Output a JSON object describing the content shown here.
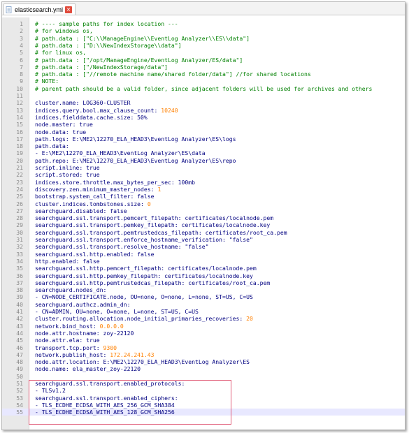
{
  "tab": {
    "filename": "elasticsearch.yml"
  },
  "lines": [
    {
      "n": "1",
      "parts": [
        [
          "comment",
          "# ---- sample paths for index location ---"
        ]
      ]
    },
    {
      "n": "2",
      "parts": [
        [
          "comment",
          "# for windows os,"
        ]
      ]
    },
    {
      "n": "3",
      "parts": [
        [
          "comment",
          "# path.data : [\"C:\\\\ManageEngine\\\\EventLog Analyzer\\\\ES\\\\data\"]"
        ]
      ]
    },
    {
      "n": "4",
      "parts": [
        [
          "comment",
          "# path.data : [\"D:\\\\NewIndexStorage\\\\data\"]"
        ]
      ]
    },
    {
      "n": "5",
      "parts": [
        [
          "comment",
          "# for linux os,"
        ]
      ]
    },
    {
      "n": "6",
      "parts": [
        [
          "comment",
          "# path.data : [\"/opt/ManageEngine/EventLog Analyzer/ES/data\"]"
        ]
      ]
    },
    {
      "n": "7",
      "parts": [
        [
          "comment",
          "# path.data : [\"/NewIndexStorage/data\"]"
        ]
      ]
    },
    {
      "n": "8",
      "parts": [
        [
          "comment",
          "# path.data : [\"//remote machine name/shared folder/data\"] //for shared locations"
        ]
      ]
    },
    {
      "n": "9",
      "parts": [
        [
          "comment",
          "# NOTE:"
        ]
      ]
    },
    {
      "n": "10",
      "parts": [
        [
          "comment",
          "# parent path should be a valid folder, since adjacent folders will be used for archives and others"
        ]
      ]
    },
    {
      "n": "11",
      "parts": []
    },
    {
      "n": "12",
      "parts": [
        [
          "key",
          "cluster.name: LOG360-CLUSTER"
        ]
      ]
    },
    {
      "n": "13",
      "parts": [
        [
          "key",
          "indices.query.bool.max_clause_count: "
        ],
        [
          "num",
          "10240"
        ]
      ]
    },
    {
      "n": "14",
      "parts": [
        [
          "key",
          "indices.fielddata.cache.size: 50%"
        ]
      ]
    },
    {
      "n": "15",
      "parts": [
        [
          "key",
          "node.master: true"
        ]
      ]
    },
    {
      "n": "16",
      "parts": [
        [
          "key",
          "node.data: true"
        ]
      ]
    },
    {
      "n": "17",
      "parts": [
        [
          "key",
          "path.logs: E:\\ME2\\12270_ELA_HEAD3\\EventLog Analyzer\\ES\\logs"
        ]
      ]
    },
    {
      "n": "18",
      "parts": [
        [
          "key",
          "path.data:"
        ]
      ]
    },
    {
      "n": "19",
      "parts": [
        [
          "plain",
          "- E:\\ME2\\12270_ELA_HEAD3\\EventLog Analyzer\\ES\\data"
        ]
      ]
    },
    {
      "n": "20",
      "parts": [
        [
          "key",
          "path.repo: E:\\ME2\\12270_ELA_HEAD3\\EventLog Analyzer\\ES\\repo"
        ]
      ]
    },
    {
      "n": "21",
      "parts": [
        [
          "key",
          "script.inline: true"
        ]
      ]
    },
    {
      "n": "22",
      "parts": [
        [
          "key",
          "script.stored: true"
        ]
      ]
    },
    {
      "n": "23",
      "parts": [
        [
          "key",
          "indices.store.throttle.max_bytes_per_sec: 100mb"
        ]
      ]
    },
    {
      "n": "24",
      "parts": [
        [
          "key",
          "discovery.zen.minimum_master_nodes: "
        ],
        [
          "num",
          "1"
        ]
      ]
    },
    {
      "n": "25",
      "parts": [
        [
          "key",
          "bootstrap.system_call_filter: false"
        ]
      ]
    },
    {
      "n": "26",
      "parts": [
        [
          "key",
          "cluster.indices.tombstones.size: "
        ],
        [
          "num",
          "0"
        ]
      ]
    },
    {
      "n": "27",
      "parts": [
        [
          "key",
          "searchguard.disabled: false"
        ]
      ]
    },
    {
      "n": "28",
      "parts": [
        [
          "key",
          "searchguard.ssl.transport.pemcert_filepath: certificates/localnode.pem"
        ]
      ]
    },
    {
      "n": "29",
      "parts": [
        [
          "key",
          "searchguard.ssl.transport.pemkey_filepath: certificates/localnode.key"
        ]
      ]
    },
    {
      "n": "30",
      "parts": [
        [
          "key",
          "searchguard.ssl.transport.pemtrustedcas_filepath: certificates/root_ca.pem"
        ]
      ]
    },
    {
      "n": "31",
      "parts": [
        [
          "key",
          "searchguard.ssl.transport.enforce_hostname_verification: \"false\""
        ]
      ]
    },
    {
      "n": "32",
      "parts": [
        [
          "key",
          "searchguard.ssl.transport.resolve_hostname: \"false\""
        ]
      ]
    },
    {
      "n": "33",
      "parts": [
        [
          "key",
          "searchguard.ssl.http.enabled: false"
        ]
      ]
    },
    {
      "n": "34",
      "parts": [
        [
          "key",
          "http.enabled: false"
        ]
      ]
    },
    {
      "n": "35",
      "parts": [
        [
          "key",
          "searchguard.ssl.http.pemcert_filepath: certificates/localnode.pem"
        ]
      ]
    },
    {
      "n": "36",
      "parts": [
        [
          "key",
          "searchguard.ssl.http.pemkey_filepath: certificates/localnode.key"
        ]
      ]
    },
    {
      "n": "37",
      "parts": [
        [
          "key",
          "searchguard.ssl.http.pemtrustedcas_filepath: certificates/root_ca.pem"
        ]
      ]
    },
    {
      "n": "38",
      "parts": [
        [
          "key",
          "searchguard.nodes_dn:"
        ]
      ]
    },
    {
      "n": "39",
      "parts": [
        [
          "plain",
          "- CN=NODE_CERTIFICATE.node, OU=none, O=none, L=none, ST=US, C=US"
        ]
      ]
    },
    {
      "n": "40",
      "parts": [
        [
          "key",
          "searchguard.authcz.admin_dn:"
        ]
      ]
    },
    {
      "n": "41",
      "parts": [
        [
          "plain",
          "- CN=ADMIN, OU=none, O=none, L=none, ST=US, C=US"
        ]
      ]
    },
    {
      "n": "42",
      "parts": [
        [
          "key",
          "cluster.routing.allocation.node_initial_primaries_recoveries: "
        ],
        [
          "num",
          "20"
        ]
      ]
    },
    {
      "n": "43",
      "parts": [
        [
          "key",
          "network.bind_host: "
        ],
        [
          "num",
          "0.0.0.0"
        ]
      ]
    },
    {
      "n": "44",
      "parts": [
        [
          "key",
          "node.attr.hostname: zoy-22120"
        ]
      ]
    },
    {
      "n": "45",
      "parts": [
        [
          "key",
          "node.attr.ela: true"
        ]
      ]
    },
    {
      "n": "46",
      "parts": [
        [
          "key",
          "transport.tcp.port: "
        ],
        [
          "num",
          "9300"
        ]
      ]
    },
    {
      "n": "47",
      "parts": [
        [
          "key",
          "network.publish_host: "
        ],
        [
          "num",
          "172.24.241.43"
        ]
      ]
    },
    {
      "n": "48",
      "parts": [
        [
          "key",
          "node.attr.location: E:\\ME2\\12270_ELA_HEAD3\\EventLog Analyzer\\ES"
        ]
      ]
    },
    {
      "n": "49",
      "parts": [
        [
          "key",
          "node.name: ela_master_zoy-22120"
        ]
      ]
    },
    {
      "n": "50",
      "parts": []
    },
    {
      "n": "51",
      "parts": [
        [
          "key",
          "searchguard.ssl.transport.enabled_protocols:"
        ]
      ]
    },
    {
      "n": "52",
      "parts": [
        [
          "plain",
          "- TLSv1.2"
        ]
      ]
    },
    {
      "n": "53",
      "parts": [
        [
          "key",
          "searchguard.ssl.transport.enabled_ciphers:"
        ]
      ]
    },
    {
      "n": "54",
      "parts": [
        [
          "plain",
          "- TLS_ECDHE_ECDSA_WITH_AES_256_GCM_SHA384"
        ]
      ]
    },
    {
      "n": "55",
      "parts": [
        [
          "plain",
          "- TLS_ECDHE_ECDSA_WITH_AES_128_GCM_SHA256"
        ]
      ]
    }
  ],
  "current_line": "55",
  "colors": {
    "comment": "#008000",
    "key": "#000080",
    "number": "#ff8000",
    "highlight_box": "#e05c77"
  }
}
